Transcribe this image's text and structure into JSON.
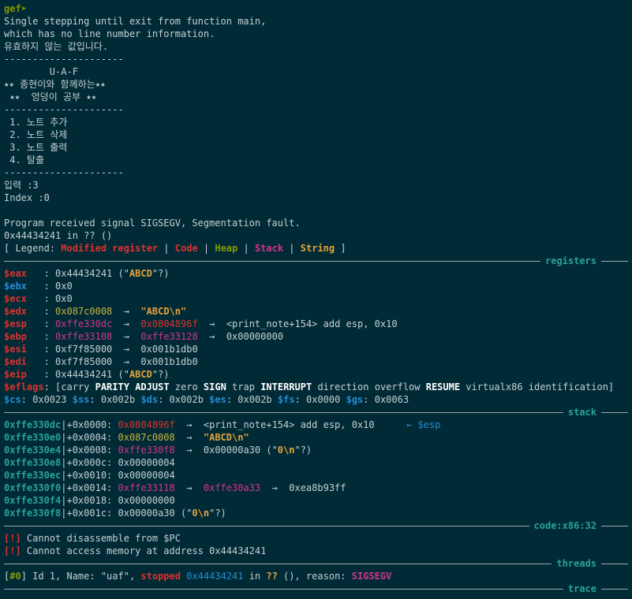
{
  "prompt": "gef➤",
  "intro": [
    "Single stepping until exit from function main,",
    "which has no line number information.",
    "유효하지 않는 값입니다.",
    "---------------------",
    "        U-A-F",
    "⭑⭑ 종현이와 함께하는⭑⭑",
    " ⭑⭑  엉덩이 공부 ⭑⭑",
    "---------------------",
    " 1. 노트 추가",
    " 2. 노트 삭제",
    " 3. 노트 출력",
    " 4. 탈출",
    "---------------------",
    "입력 :3",
    "Index :0",
    "",
    "Program received signal SIGSEGV, Segmentation fault.",
    "0x44434241 in ?? ()"
  ],
  "legend": {
    "open": "[ Legend: ",
    "modified": "Modified register",
    "sep": " | ",
    "code": "Code",
    "heap": "Heap",
    "stack": "Stack",
    "string": "String",
    "close": " ]"
  },
  "sections": {
    "registers": "registers",
    "stack": "stack",
    "code": "code:x86:32",
    "threads": "threads",
    "trace": "trace"
  },
  "registers": {
    "eax": {
      "name": "$eax",
      "val": "0x44434241 (\"",
      "str": "ABCD",
      "tail": "\"?)"
    },
    "ebx": {
      "name": "$ebx",
      "val": "0x0"
    },
    "ecx": {
      "name": "$ecx",
      "val": "0x0"
    },
    "edx": {
      "name": "$edx",
      "addr": "0x087c0008",
      "arrow": "→",
      "str": "\"ABCD\\n\""
    },
    "esp": {
      "name": "$esp",
      "addr": "0xffe330dc",
      "arrow": "→",
      "addr2": "0x0804896f",
      "arrow2": "→",
      "rest": "<print_note+154> add esp, 0x10"
    },
    "ebp": {
      "name": "$ebp",
      "addr": "0xffe33108",
      "arrow": "→",
      "addr2": "0xffe33128",
      "arrow2": "→",
      "rest": "0x00000000"
    },
    "esi": {
      "name": "$esi",
      "val": "0xf7f85000",
      "arrow": "→",
      "rest": "0x001b1db0"
    },
    "edi": {
      "name": "$edi",
      "val": "0xf7f85000",
      "arrow": "→",
      "rest": "0x001b1db0"
    },
    "eip": {
      "name": "$eip",
      "val": "0x44434241 (\"",
      "str": "ABCD",
      "tail": "\"?)"
    },
    "eflags": {
      "name": "$eflags",
      "open": "[carry ",
      "parity": "PARITY",
      "adjust": "ADJUST",
      "zero": " zero ",
      "sign": "SIGN",
      "trap": " trap ",
      "interrupt": "INTERRUPT",
      "mid": " direction overflow ",
      "resume": "RESUME",
      "close": " virtualx86 identification]"
    },
    "segs": {
      "cs": "$cs",
      "cs_v": ": 0x0023 ",
      "ss": "$ss",
      "ss_v": ": 0x002b ",
      "ds": "$ds",
      "ds_v": ": 0x002b ",
      "es": "$es",
      "es_v": ": 0x002b ",
      "fs": "$fs",
      "fs_v": ": 0x0000 ",
      "gs": "$gs",
      "gs_v": ": 0x0063"
    }
  },
  "stack": [
    {
      "addr": "0xffe330dc",
      "off": "|+0x0000: ",
      "v1": "0x0804896f",
      "a1": "  →  ",
      "rest": "<print_note+154> add esp, 0x10",
      "esp": "← $esp"
    },
    {
      "addr": "0xffe330e0",
      "off": "|+0x0004: ",
      "v1": "0x087c0008",
      "a1": "  →  ",
      "str": "\"ABCD\\n\""
    },
    {
      "addr": "0xffe330e4",
      "off": "|+0x0008: ",
      "v1": "0xffe330f8",
      "a1": "  →  ",
      "rest": "0x00000a30 (\"",
      "str": "0\\n",
      "tail": "\"?)"
    },
    {
      "addr": "0xffe330e8",
      "off": "|+0x000c: ",
      "plain": "0x00000004"
    },
    {
      "addr": "0xffe330ec",
      "off": "|+0x0010: ",
      "plain": "0x00000004"
    },
    {
      "addr": "0xffe330f0",
      "off": "|+0x0014: ",
      "v1": "0xffe33118",
      "a1": "  →  ",
      "v2": "0xffe30a33",
      "a2": "  →  ",
      "rest": "0xea8b93ff"
    },
    {
      "addr": "0xffe330f4",
      "off": "|+0x0018: ",
      "plain": "0x00000000"
    },
    {
      "addr": "0xffe330f8",
      "off": "|+0x001c: ",
      "plain": "0x00000a30 (\"",
      "str": "0\\n",
      "tail": "\"?)"
    }
  ],
  "code": [
    {
      "tag": "[!]",
      "msg": " Cannot disassemble from $PC"
    },
    {
      "tag": "[!]",
      "msg": " Cannot access memory at address 0x44434241"
    }
  ],
  "thread": {
    "open": "[",
    "id": "#0",
    "mid": "] Id 1, Name: \"uaf\", ",
    "stopped": "stopped",
    "addr": "0x44434241",
    "in": " in ",
    "q": "??",
    "rest": " (), reason: ",
    "reason": "SIGSEGV"
  }
}
